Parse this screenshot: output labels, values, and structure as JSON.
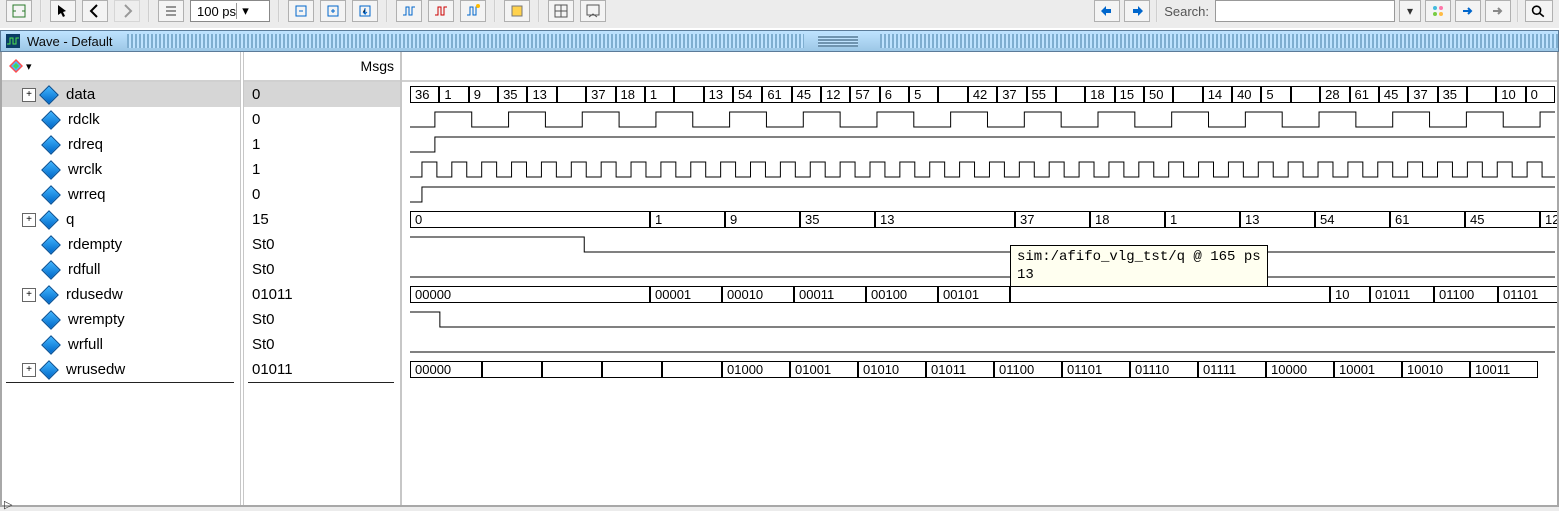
{
  "toolbar": {
    "time_value": "100 ps",
    "search_label": "Search:"
  },
  "window": {
    "title": "Wave - Default"
  },
  "headers": {
    "msgs": "Msgs"
  },
  "tooltip": {
    "line1": "sim:/afifo_vlg_tst/q @ 165 ps",
    "line2": "13"
  },
  "signals": [
    {
      "name": "data",
      "msg": "0",
      "expandable": true,
      "selected": true
    },
    {
      "name": "rdclk",
      "msg": "0",
      "expandable": false,
      "selected": false
    },
    {
      "name": "rdreq",
      "msg": "1",
      "expandable": false,
      "selected": false
    },
    {
      "name": "wrclk",
      "msg": "1",
      "expandable": false,
      "selected": false
    },
    {
      "name": "wrreq",
      "msg": "0",
      "expandable": false,
      "selected": false
    },
    {
      "name": "q",
      "msg": "15",
      "expandable": true,
      "selected": false
    },
    {
      "name": "rdempty",
      "msg": "St0",
      "expandable": false,
      "selected": false
    },
    {
      "name": "rdfull",
      "msg": "St0",
      "expandable": false,
      "selected": false
    },
    {
      "name": "rdusedw",
      "msg": "01011",
      "expandable": true,
      "selected": false
    },
    {
      "name": "wrempty",
      "msg": "St0",
      "expandable": false,
      "selected": false
    },
    {
      "name": "wrfull",
      "msg": "St0",
      "expandable": false,
      "selected": false
    },
    {
      "name": "wrusedw",
      "msg": "01011",
      "expandable": true,
      "selected": false
    }
  ],
  "lanes": {
    "data_bus": [
      "36",
      "1",
      "9",
      "35",
      "13",
      "",
      "37",
      "18",
      "1",
      "",
      "13",
      "54",
      "61",
      "45",
      "12",
      "57",
      "6",
      "5",
      "",
      "42",
      "37",
      "55",
      "",
      "18",
      "15",
      "50",
      "",
      "14",
      "40",
      "5",
      "",
      "28",
      "61",
      "45",
      "37",
      "35",
      "",
      "10",
      "0"
    ],
    "q_bus": [
      "0",
      "1",
      "9",
      "35",
      "13",
      "37",
      "18",
      "1",
      "13",
      "54",
      "61",
      "45",
      "12"
    ],
    "rdusedw_bus_left": [
      "00000"
    ],
    "rdusedw_bus_mid": [
      "00001",
      "00010",
      "00011",
      "00100",
      "00101"
    ],
    "rdusedw_bus_right": [
      "10",
      "01011",
      "01100",
      "01101"
    ],
    "wrusedw_bus_left": [
      "00000"
    ],
    "wrusedw_bus_mid": [
      "",
      "",
      "",
      "",
      "01000",
      "01001",
      "01010",
      "01011",
      "01100",
      "01101",
      "01110",
      "01111",
      "10000",
      "10001",
      "10010",
      "10011"
    ]
  }
}
